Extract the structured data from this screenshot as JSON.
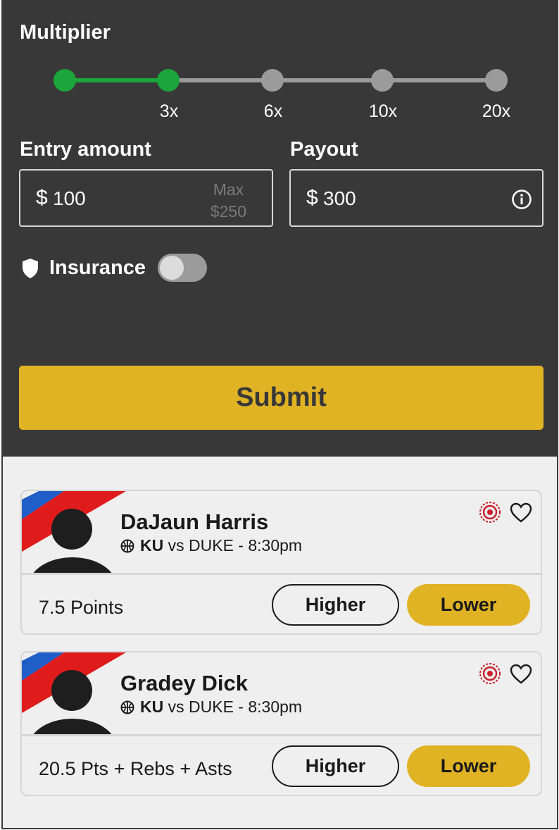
{
  "multiplier": {
    "title": "Multiplier",
    "selected_index": 1,
    "ticks": [
      "",
      "3x",
      "6x",
      "10x",
      "20x"
    ]
  },
  "entry": {
    "label": "Entry amount",
    "currency": "$",
    "value": "100",
    "max_line1": "Max",
    "max_line2": "$250"
  },
  "payout": {
    "label": "Payout",
    "currency": "$",
    "value": "300",
    "info_icon": "info-icon"
  },
  "insurance": {
    "label": "Insurance",
    "enabled": false,
    "icon": "shield-icon"
  },
  "submit_label": "Submit",
  "picks": [
    {
      "player": "DaJaun Harris",
      "team": "KU",
      "matchup": "vs DUKE - 8:30pm",
      "stat": "7.5 Points",
      "higher_label": "Higher",
      "lower_label": "Lower"
    },
    {
      "player": "Gradey Dick",
      "team": "KU",
      "matchup": "vs DUKE - 8:30pm",
      "stat": "20.5 Pts + Rebs + Asts",
      "higher_label": "Higher",
      "lower_label": "Lower"
    }
  ],
  "colors": {
    "accent_green": "#1ba53a",
    "accent_gold": "#e0b325",
    "panel_dark": "#383838",
    "target_red": "#c8202a"
  }
}
